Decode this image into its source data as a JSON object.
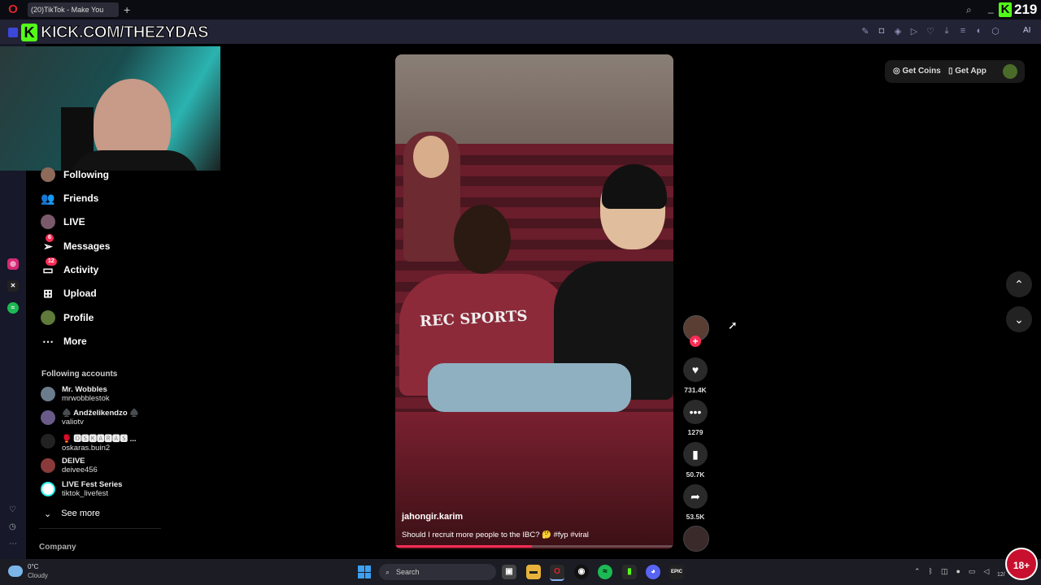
{
  "browser": {
    "tab_title": "(20)TikTok - Make You",
    "new_tab": "+",
    "kick_letter": "K",
    "viewer_count": "219",
    "banner_url": "KICK.COM/THEZYDAS",
    "ai_label": "AI"
  },
  "nav": {
    "items": [
      {
        "label": "Following"
      },
      {
        "label": "Friends"
      },
      {
        "label": "LIVE"
      },
      {
        "label": "Messages",
        "badge": "6"
      },
      {
        "label": "Activity",
        "badge": "12"
      },
      {
        "label": "Upload"
      },
      {
        "label": "Profile"
      },
      {
        "label": "More"
      }
    ]
  },
  "following": {
    "title": "Following accounts",
    "accounts": [
      {
        "name": "Mr. Wobbles",
        "handle": "mrwobblestok"
      },
      {
        "name": "♠️ Andželikendzo ♠️",
        "handle": "valiotv"
      },
      {
        "name": "🥊 🅾🆂🅺🅰🆁🅰🆂 ...",
        "handle": "oskaras.buin2"
      },
      {
        "name": "DEIVE",
        "handle": "deivee456"
      },
      {
        "name": "LIVE Fest Series",
        "handle": "tiktok_livefest"
      }
    ],
    "see_more": "See more"
  },
  "footer": {
    "company": "Company"
  },
  "video": {
    "username": "jahongir.karim",
    "caption": "Should I recruit more people to the IBC? 🤔 #fyp #viral",
    "shirt_text": "REC SPORTS",
    "progress": 0.49
  },
  "actions": {
    "likes": "731.4K",
    "comments": "1279",
    "saves": "50.7K",
    "shares": "53.5K"
  },
  "top_right": {
    "get_coins": "Get Coins",
    "get_app": "Get App"
  },
  "taskbar": {
    "temp": "0°C",
    "condition": "Cloudy",
    "search_placeholder": "Search",
    "age_badge": "18+",
    "clock_fragment": "12/"
  },
  "colors": {
    "accent": "#fe2c55",
    "kick_green": "#53fc18"
  }
}
